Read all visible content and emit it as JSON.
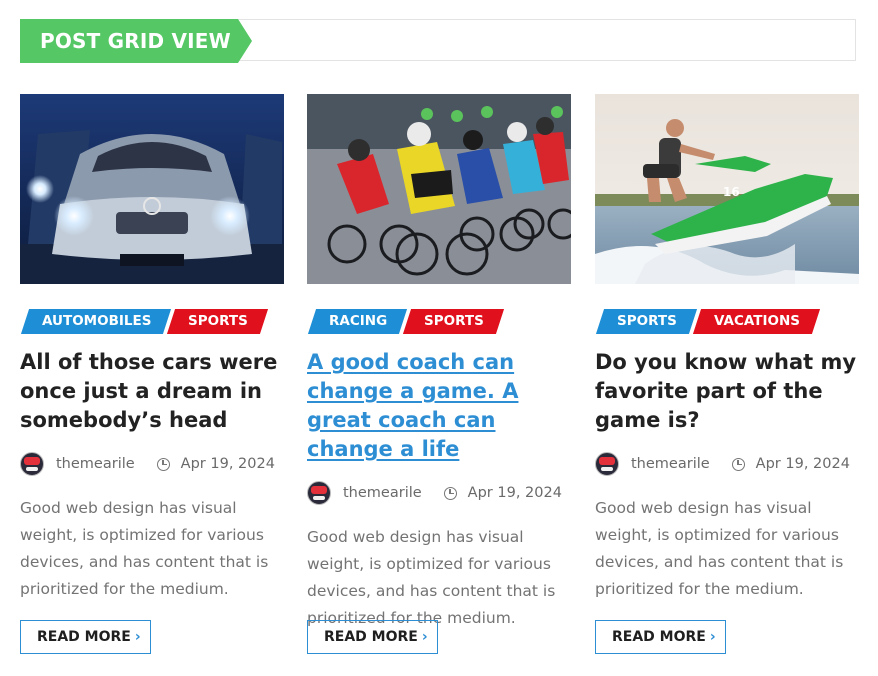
{
  "section": {
    "title": "POST GRID VIEW",
    "accent": "#56c765"
  },
  "colors": {
    "category_blue": "#1e8fd6",
    "category_red": "#e0101d",
    "link": "#2d8ed4"
  },
  "posts": [
    {
      "image": "car-headlights",
      "categories": [
        "AUTOMOBILES",
        "SPORTS"
      ],
      "title": "All of those cars were once just a dream in somebody’s head",
      "author": "themearile",
      "date": "Apr 19, 2024",
      "excerpt": "Good web design has visual weight, is optimized for various devices, and has content that is prioritized for the medium.",
      "read_more": "READ MORE"
    },
    {
      "image": "cycling-race",
      "categories": [
        "RACING",
        "SPORTS"
      ],
      "title": "A good coach can change a game. A great coach can change a life",
      "author": "themearile",
      "date": "Apr 19, 2024",
      "excerpt": "Good web design has visual weight, is optimized for various devices, and has content that is prioritized for the medium.",
      "read_more": "READ MORE"
    },
    {
      "image": "jet-ski",
      "categories": [
        "SPORTS",
        "VACATIONS"
      ],
      "title": "Do you know what my favorite part of the game is?",
      "author": "themearile",
      "date": "Apr 19, 2024",
      "excerpt": "Good web design has visual weight, is optimized for various devices, and has content that is prioritized for the medium.",
      "read_more": "READ MORE"
    }
  ]
}
